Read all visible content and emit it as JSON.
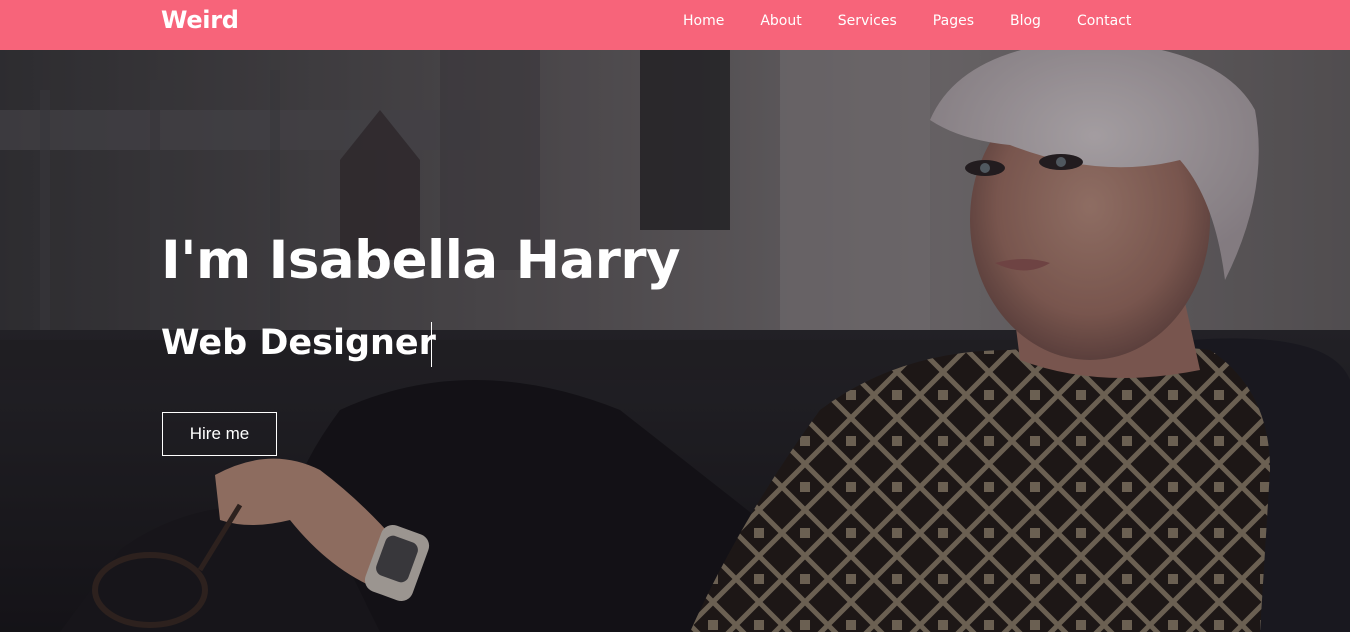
{
  "navbar": {
    "brand": "Weird",
    "menu": [
      {
        "label": "Home"
      },
      {
        "label": "About"
      },
      {
        "label": "Services"
      },
      {
        "label": "Pages"
      },
      {
        "label": "Blog"
      },
      {
        "label": "Contact"
      }
    ]
  },
  "hero": {
    "title": "I'm Isabella Harry",
    "subtitle": "Web Designer",
    "cta_label": "Hire me"
  },
  "colors": {
    "navbar_bg": "#f7647a",
    "text": "#ffffff",
    "hero_overlay": "#121014"
  }
}
